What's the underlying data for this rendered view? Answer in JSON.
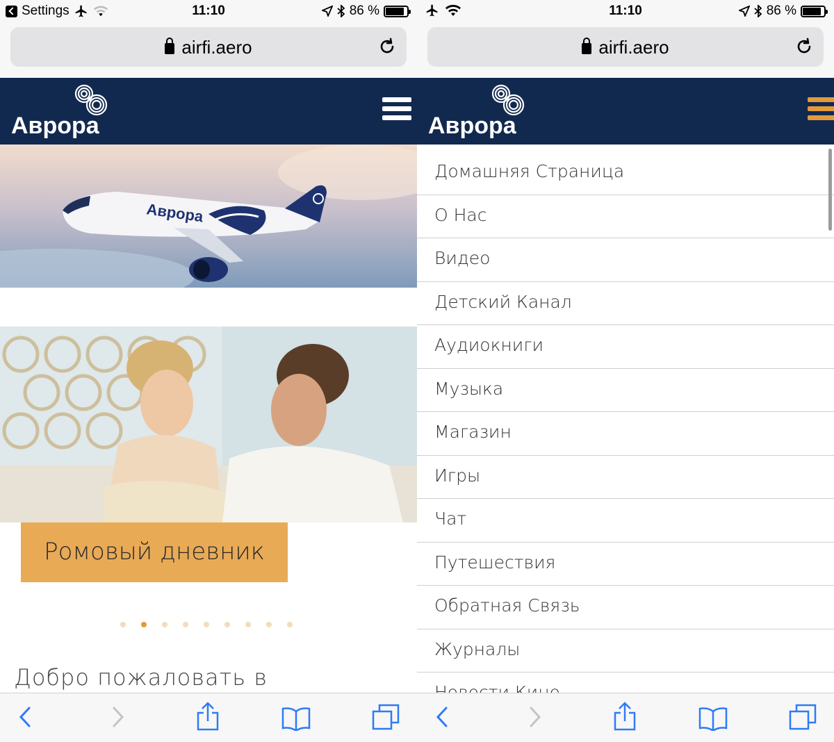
{
  "left": {
    "status": {
      "back_app": "Settings",
      "time": "11:10",
      "battery": "86 %",
      "battery_level": 0.86
    },
    "url": "airfi.aero",
    "logo_text": "Аврора",
    "plane_livery": "Аврора",
    "slide_caption": "Ромовый дневник",
    "carousel": {
      "count": 9,
      "active_index": 1
    },
    "welcome": "Добро пожаловать в"
  },
  "right": {
    "status": {
      "time": "11:10",
      "battery": "86 %",
      "battery_level": 0.86
    },
    "url": "airfi.aero",
    "logo_text": "Аврора",
    "menu_items": [
      "Домашняя Страница",
      "О Нас",
      "Видео",
      "Детский Канал",
      "Аудиокниги",
      "Музыка",
      "Магазин",
      "Игры",
      "Чат",
      "Путешествия",
      "Обратная Связь",
      "Журналы",
      "Новости Кино"
    ]
  },
  "colors": {
    "header_bg": "#12294f",
    "accent_orange": "#e9aa56",
    "hamburger_open": "#e39a3a",
    "toolbar_blue": "#2f7bf5"
  },
  "icons": [
    "back-icon",
    "forward-icon",
    "share-icon",
    "bookmarks-icon",
    "tabs-icon",
    "lock-icon",
    "reload-icon",
    "airplane-icon",
    "wifi-icon",
    "location-icon",
    "bluetooth-icon",
    "battery-icon",
    "hamburger-icon"
  ]
}
